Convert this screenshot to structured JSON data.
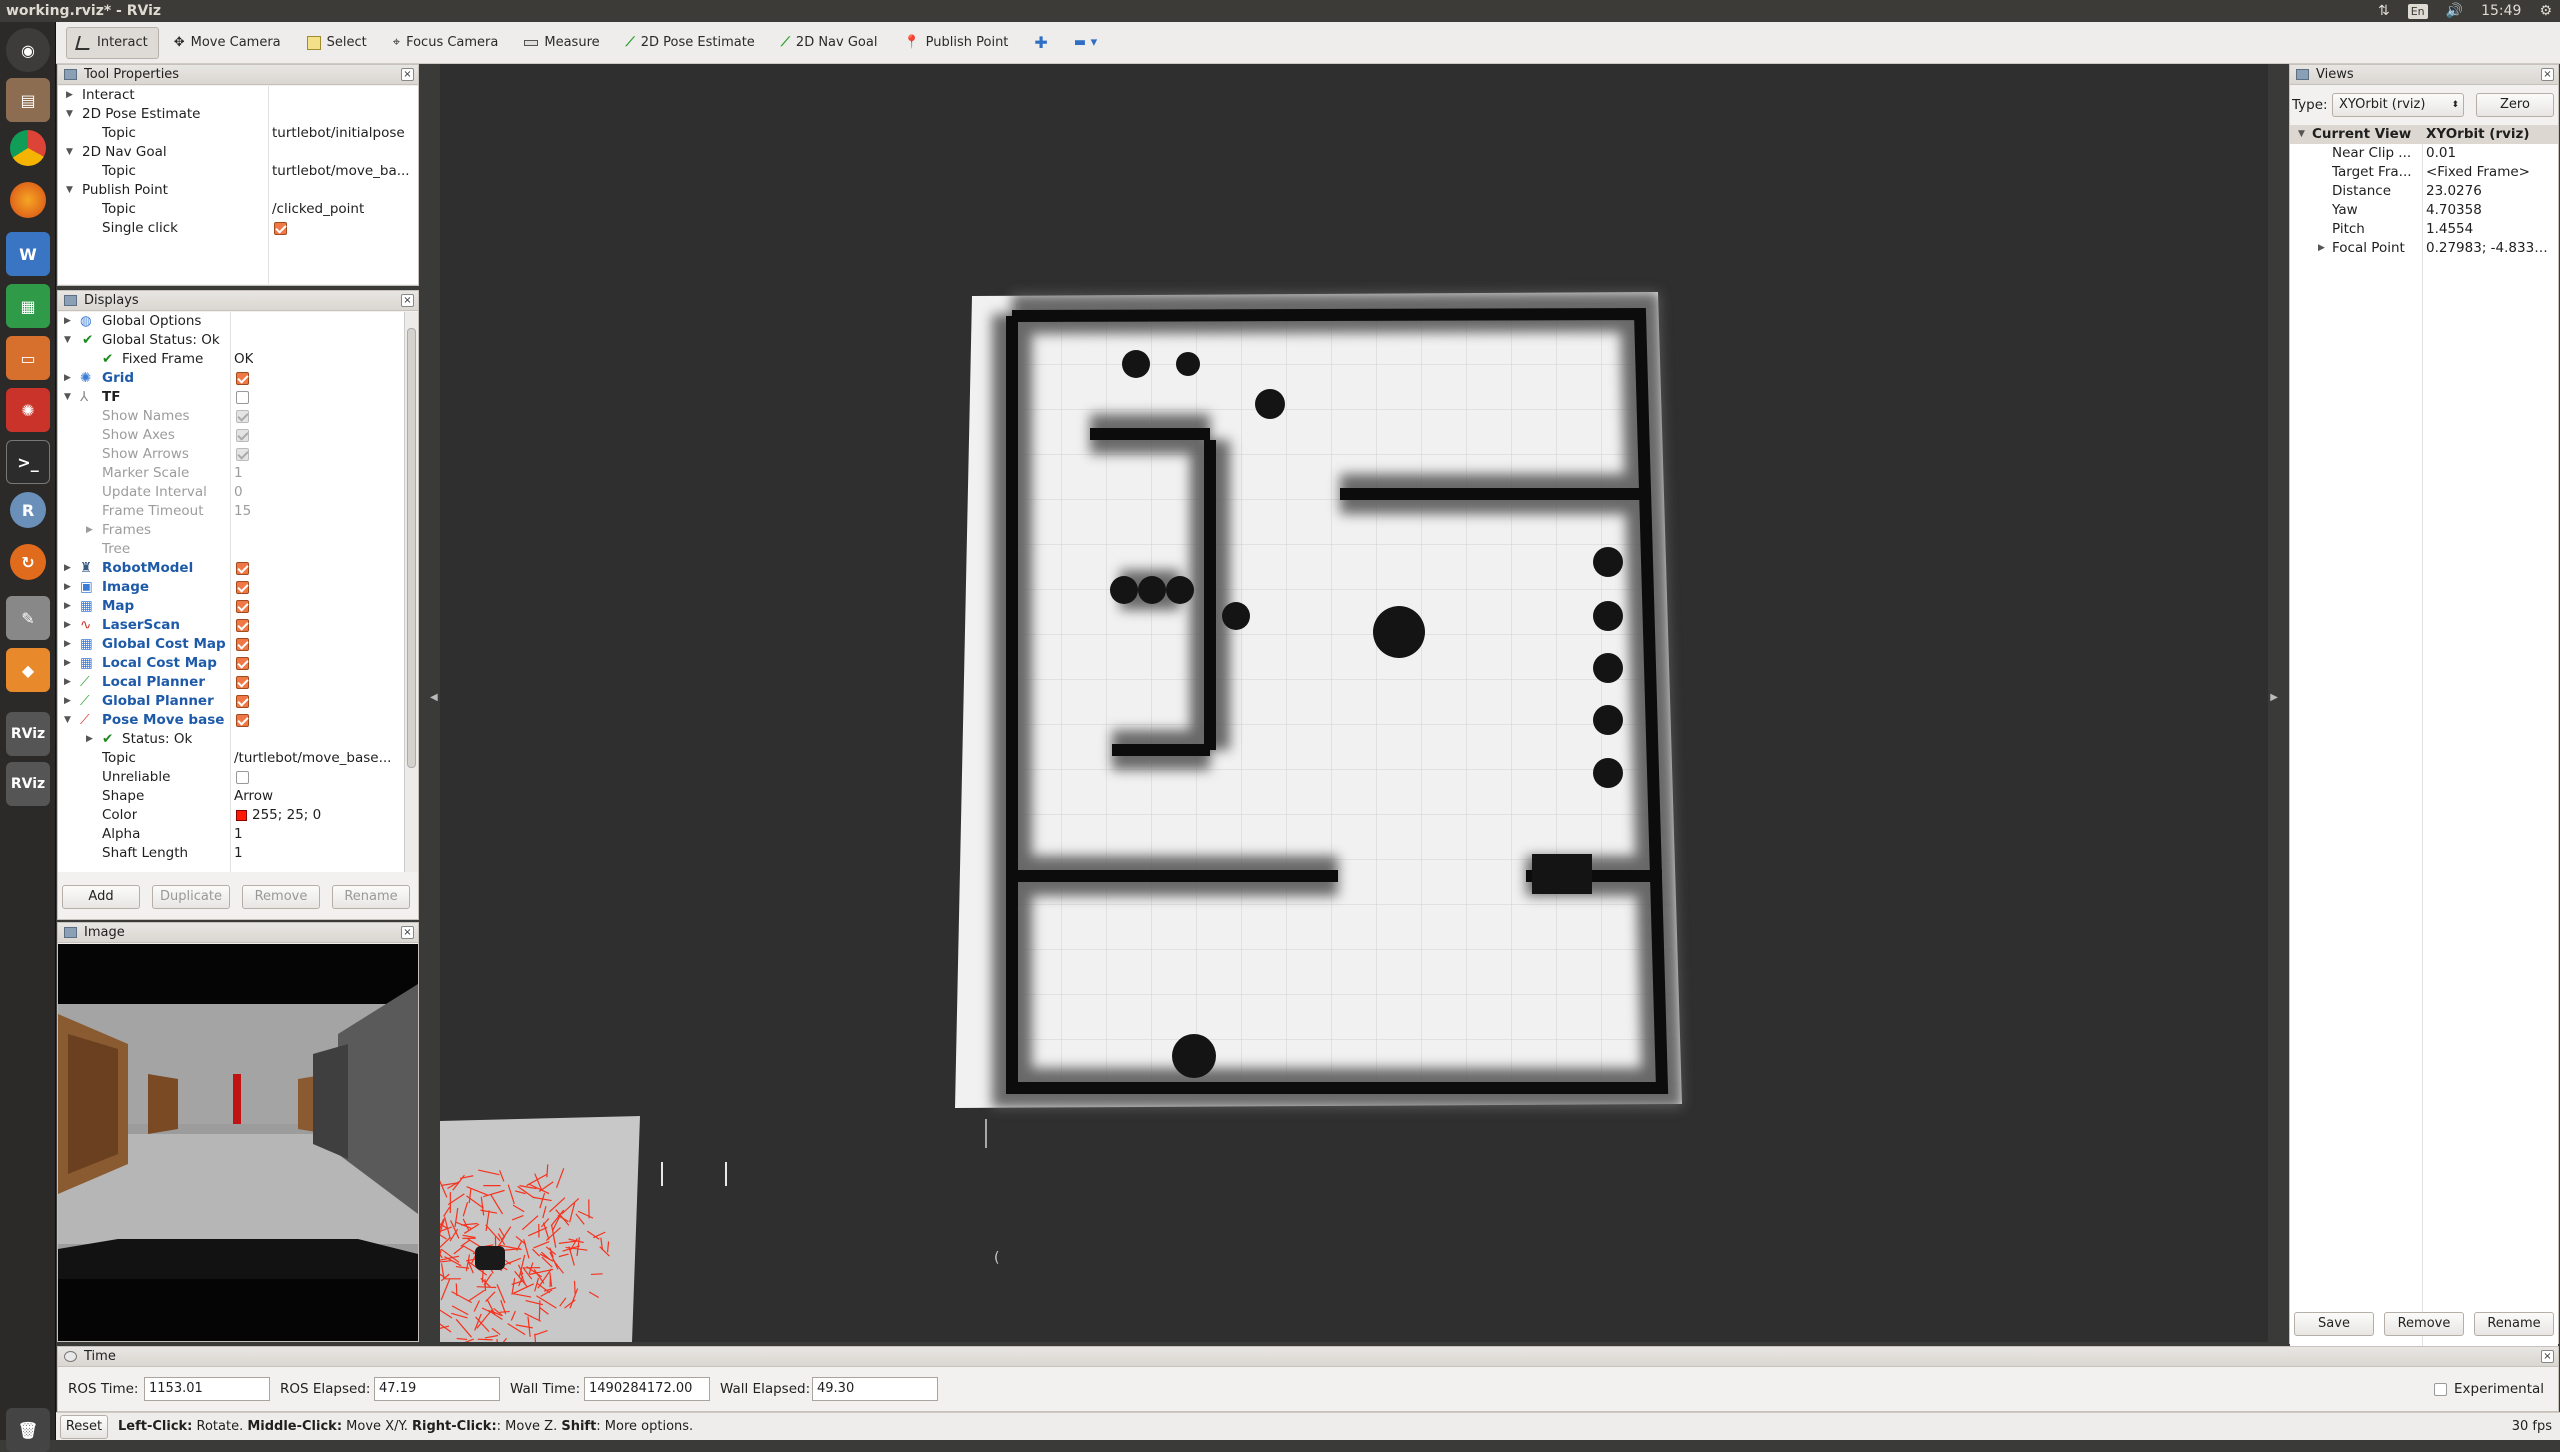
{
  "window": {
    "title": "working.rviz* - RViz",
    "clock": "15:49",
    "keyboard": "En"
  },
  "launcher": {
    "items": [
      "Ubuntu Dash",
      "Files",
      "Chrome",
      "Firefox",
      "LibreOffice Writer",
      "LibreOffice Calc",
      "LibreOffice Impress",
      "Rviz Ubuntu",
      "Terminal",
      "RStudio",
      "Software Updater",
      "Text Editor",
      "Sublime",
      "RViz",
      "RViz",
      "Trash"
    ]
  },
  "toolbar": {
    "interact": "Interact",
    "move_camera": "Move Camera",
    "select": "Select",
    "focus_camera": "Focus Camera",
    "measure": "Measure",
    "pose_estimate": "2D Pose Estimate",
    "nav_goal": "2D Nav Goal",
    "publish_point": "Publish Point"
  },
  "tool_properties": {
    "title": "Tool Properties",
    "rows": {
      "interact": "Interact",
      "pose_estimate": "2D Pose Estimate",
      "pose_topic_k": "Topic",
      "pose_topic_v": "turtlebot/initialpose",
      "nav_goal": "2D Nav Goal",
      "nav_topic_k": "Topic",
      "nav_topic_v": "turtlebot/move_ba...",
      "publish_point": "Publish Point",
      "pp_topic_k": "Topic",
      "pp_topic_v": "/clicked_point",
      "single_click": "Single click"
    }
  },
  "displays": {
    "title": "Displays",
    "global_options": "Global Options",
    "global_status": "Global Status: Ok",
    "fixed_frame_k": "Fixed Frame",
    "fixed_frame_v": "OK",
    "grid": "Grid",
    "tf": "TF",
    "show_names": "Show Names",
    "show_axes": "Show Axes",
    "show_arrows": "Show Arrows",
    "marker_scale_k": "Marker Scale",
    "marker_scale_v": "1",
    "update_interval_k": "Update Interval",
    "update_interval_v": "0",
    "frame_timeout_k": "Frame Timeout",
    "frame_timeout_v": "15",
    "frames": "Frames",
    "tree": "Tree",
    "robot_model": "RobotModel",
    "image": "Image",
    "map": "Map",
    "laser_scan": "LaserScan",
    "global_cost_map": "Global Cost Map",
    "local_cost_map": "Local Cost Map",
    "local_planner": "Local Planner",
    "global_planner": "Global Planner",
    "pose_move_base": "Pose Move base",
    "status_ok": "Status: Ok",
    "topic_k": "Topic",
    "topic_v": "/turtlebot/move_base...",
    "unreliable": "Unreliable",
    "shape_k": "Shape",
    "shape_v": "Arrow",
    "color_k": "Color",
    "color_v": "255; 25; 0",
    "color_hex": "#ff1900",
    "alpha_k": "Alpha",
    "alpha_v": "1",
    "shaft_length_k": "Shaft Length",
    "shaft_length_v": "1",
    "buttons": {
      "add": "Add",
      "duplicate": "Duplicate",
      "remove": "Remove",
      "rename": "Rename"
    }
  },
  "image_panel": {
    "title": "Image"
  },
  "views": {
    "title": "Views",
    "type_label": "Type:",
    "type_value": "XYOrbit (rviz)",
    "zero": "Zero",
    "current_view_k": "Current View",
    "current_view_v": "XYOrbit (rviz)",
    "near_clip_k": "Near Clip ...",
    "near_clip_v": "0.01",
    "target_frame_k": "Target Fra...",
    "target_frame_v": "<Fixed Frame>",
    "distance_k": "Distance",
    "distance_v": "23.0276",
    "yaw_k": "Yaw",
    "yaw_v": "4.70358",
    "pitch_k": "Pitch",
    "pitch_v": "1.4554",
    "focal_point_k": "Focal Point",
    "focal_point_v": "0.27983; -4.8332;...",
    "buttons": {
      "save": "Save",
      "remove": "Remove",
      "rename": "Rename"
    }
  },
  "time_panel": {
    "title": "Time",
    "ros_time_label": "ROS Time:",
    "ros_time": "1153.01",
    "ros_elapsed_label": "ROS Elapsed:",
    "ros_elapsed": "47.19",
    "wall_time_label": "Wall Time:",
    "wall_time": "1490284172.00",
    "wall_elapsed_label": "Wall Elapsed:",
    "wall_elapsed": "49.30",
    "experimental": "Experimental"
  },
  "status": {
    "reset": "Reset",
    "left_click_k": "Left-Click:",
    "left_click_v": " Rotate. ",
    "middle_click_k": "Middle-Click:",
    "middle_click_v": " Move X/Y. ",
    "right_click_k": "Right-Click:",
    "right_click_v": ": Move Z. ",
    "shift_k": "Shift",
    "shift_v": ": More options.",
    "fps": "30 fps"
  }
}
